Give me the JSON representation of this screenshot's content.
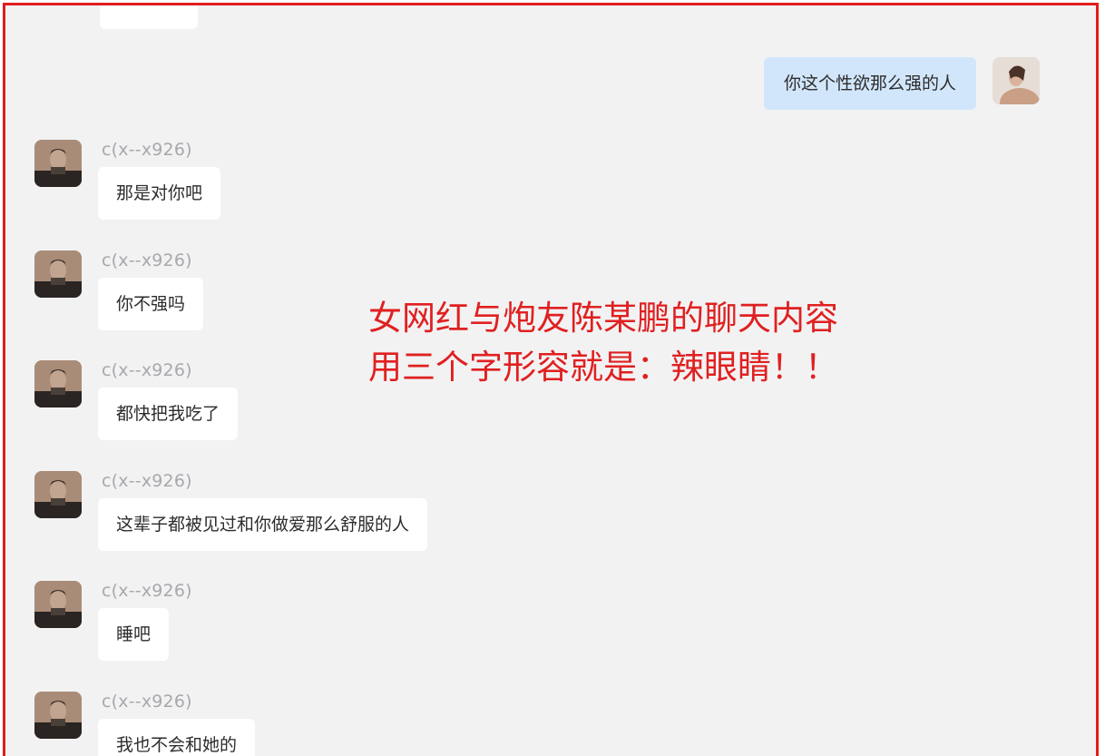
{
  "colors": {
    "frame_border": "#e11d1d",
    "chat_background": "#f2f2f3",
    "incoming_bubble": "#ffffff",
    "outgoing_bubble": "#d2e6fb",
    "sender_name": "#a8a8ad",
    "overlay_text": "#e02020"
  },
  "outgoing": [
    {
      "text": "你这个性欲那么强的人"
    }
  ],
  "incoming": [
    {
      "sender": "c(x--x926)",
      "text": "那是对你吧"
    },
    {
      "sender": "c(x--x926)",
      "text": "你不强吗"
    },
    {
      "sender": "c(x--x926)",
      "text": "都快把我吃了"
    },
    {
      "sender": "c(x--x926)",
      "text": "这辈子都被见过和你做爱那么舒服的人"
    },
    {
      "sender": "c(x--x926)",
      "text": "睡吧"
    },
    {
      "sender": "c(x--x926)",
      "text": "我也不会和她的"
    }
  ],
  "overlay": {
    "line1": "女网红与炮友陈某鹏的聊天内容",
    "line2": "用三个字形容就是：辣眼睛！！"
  }
}
